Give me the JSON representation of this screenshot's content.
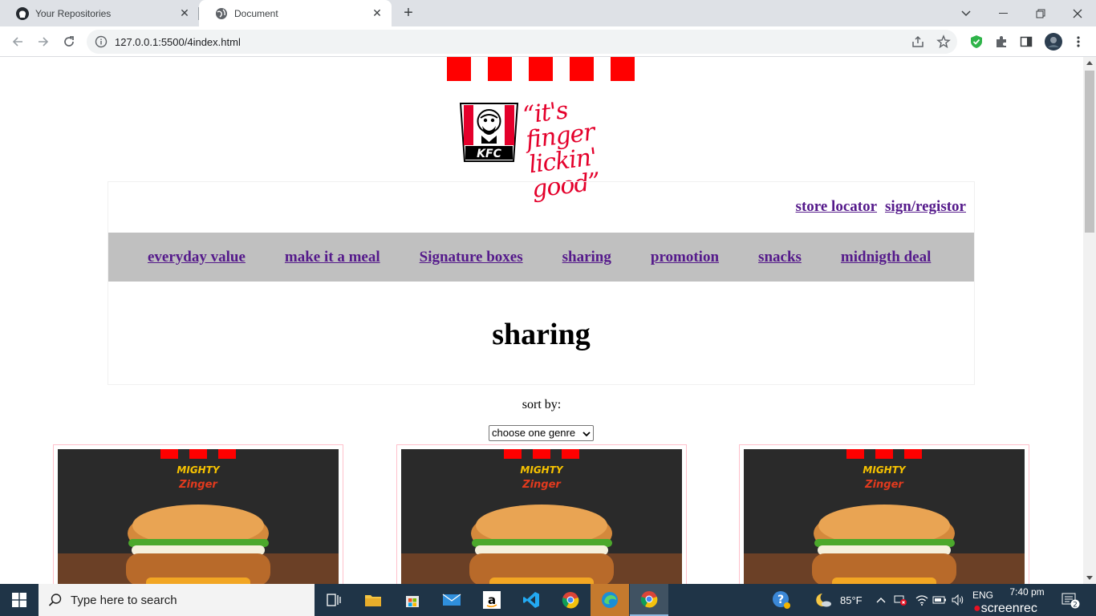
{
  "browser": {
    "tabs": [
      {
        "title": "Your Repositories",
        "icon": "github-icon",
        "active": false
      },
      {
        "title": "Document",
        "icon": "globe-icon",
        "active": true
      }
    ],
    "url": "127.0.0.1:5500/4index.html"
  },
  "page": {
    "logo_slogan_line1": "“it's finger",
    "logo_slogan_line2": "lickin' good”",
    "logo_brand": "KFC",
    "top_links": [
      "store locator",
      "sign/registor"
    ],
    "menu": [
      "everyday value",
      "make it a meal",
      "Signature boxes",
      "sharing",
      "promotion",
      "snacks",
      "midnigth deal"
    ],
    "section_title": "sharing",
    "sort_label": "sort by:",
    "sort_select_value": "choose one genre",
    "card_brand_text": "MIGHTY",
    "card_brand_subtext": "Zinger",
    "brand_color": "#ff0000"
  },
  "taskbar": {
    "search_placeholder": "Type here to search",
    "weather": "85°F",
    "language": "ENG",
    "time": "7:40 pm",
    "screenrec": "screenrec",
    "notifications": "2"
  }
}
